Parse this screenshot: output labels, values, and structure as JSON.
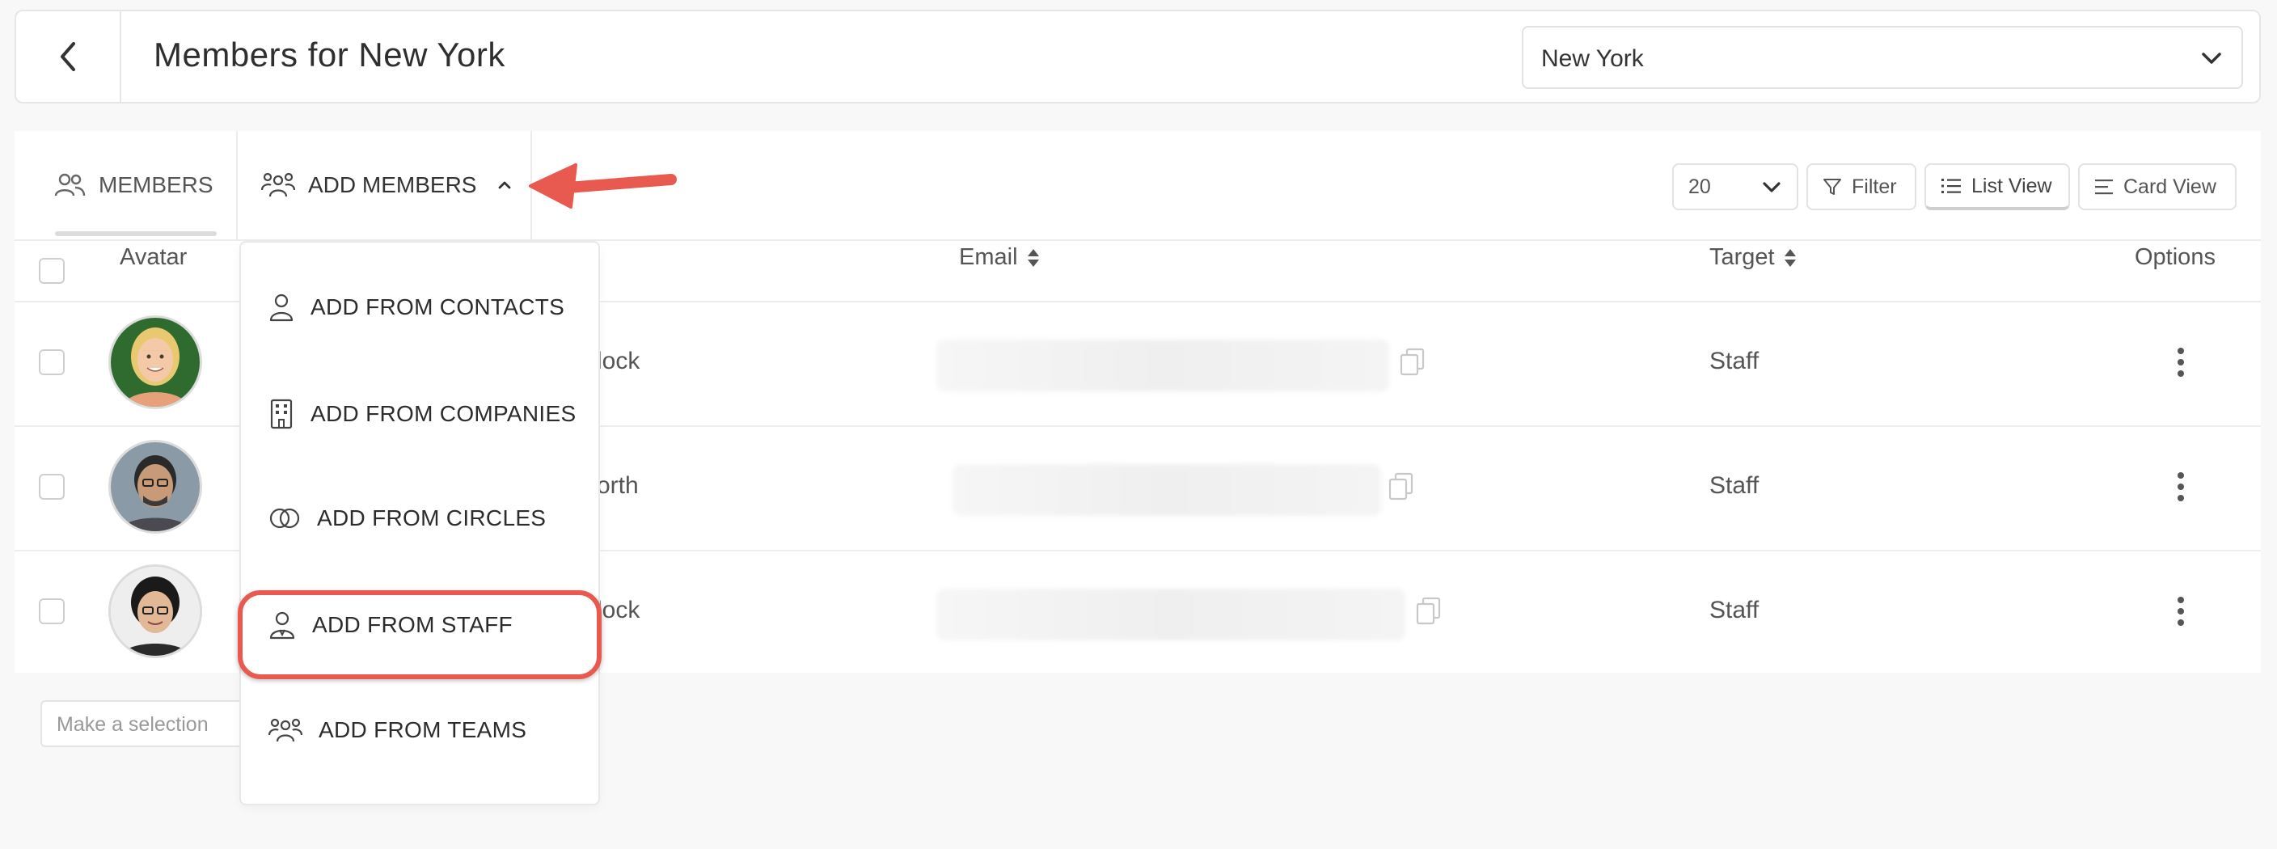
{
  "header": {
    "title": "Members for New York",
    "location_value": "New York"
  },
  "tabs": {
    "members_label": "MEMBERS",
    "add_members_label": "ADD MEMBERS"
  },
  "controls": {
    "page_size": "20",
    "filter_label": "Filter",
    "list_view_label": "List View",
    "card_view_label": "Card View"
  },
  "table": {
    "headers": {
      "avatar": "Avatar",
      "email": "Email",
      "target": "Target",
      "options": "Options"
    },
    "rows": [
      {
        "name_fragment": "lock",
        "target": "Staff"
      },
      {
        "name_fragment": "orth",
        "target": "Staff"
      },
      {
        "name_fragment": "lock",
        "target": "Staff"
      }
    ]
  },
  "selection_placeholder": "Make a selection",
  "add_menu": {
    "items": [
      {
        "label": "ADD FROM CONTACTS",
        "icon": "person-icon"
      },
      {
        "label": "ADD FROM COMPANIES",
        "icon": "building-icon"
      },
      {
        "label": "ADD FROM CIRCLES",
        "icon": "circles-icon"
      },
      {
        "label": "ADD FROM STAFF",
        "icon": "staff-icon"
      },
      {
        "label": "ADD FROM TEAMS",
        "icon": "team-icon"
      }
    ]
  },
  "colors": {
    "annotation": "#e85a50"
  }
}
